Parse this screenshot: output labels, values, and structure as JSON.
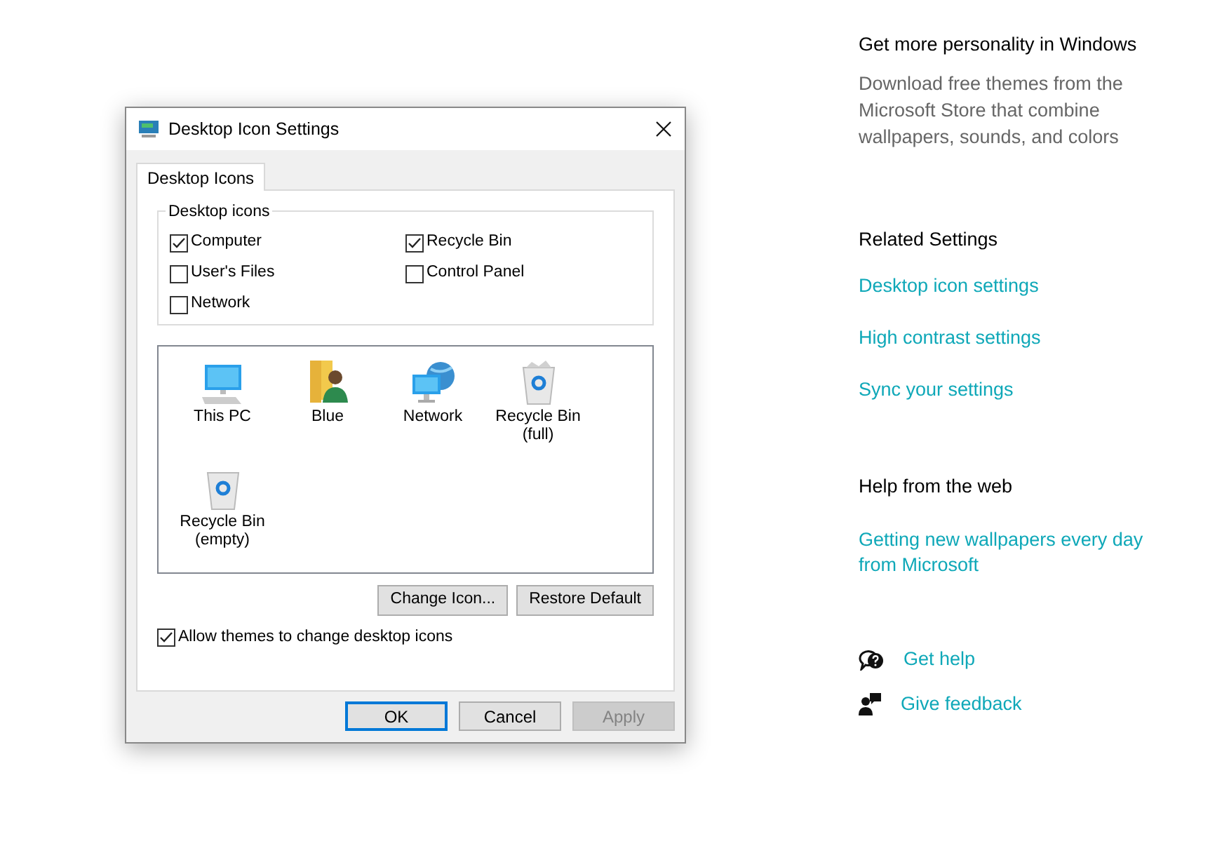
{
  "dialog": {
    "title": "Desktop Icon Settings",
    "tabs": [
      {
        "label": "Desktop Icons",
        "selected": true
      }
    ],
    "group_label": "Desktop icons",
    "checkboxes": [
      {
        "label": "Computer",
        "checked": true
      },
      {
        "label": "Recycle Bin",
        "checked": true
      },
      {
        "label": "User's Files",
        "checked": false
      },
      {
        "label": "Control Panel",
        "checked": false
      },
      {
        "label": "Network",
        "checked": false
      }
    ],
    "icons": [
      {
        "kind": "pc",
        "label": "This PC",
        "selected": false
      },
      {
        "kind": "user",
        "label": "Blue",
        "selected": false
      },
      {
        "kind": "network",
        "label": "Network",
        "selected": false
      },
      {
        "kind": "bin-full",
        "label": "Recycle Bin (full)",
        "selected": false
      },
      {
        "kind": "bin-empty",
        "label": "Recycle Bin (empty)",
        "selected": false
      }
    ],
    "icon_buttons": [
      "Change Icon...",
      "Restore Default"
    ],
    "allow_themes": {
      "label": "Allow themes to change desktop icons",
      "checked": true
    },
    "buttons": [
      {
        "label": "OK",
        "default": true,
        "disabled": false
      },
      {
        "label": "Cancel",
        "default": false,
        "disabled": false
      },
      {
        "label": "Apply",
        "default": false,
        "disabled": true
      }
    ]
  },
  "sidebar": {
    "personality": {
      "title": "Get more personality in Windows",
      "text": "Download free themes from the Microsoft Store that combine wallpapers, sounds, and colors"
    },
    "related": {
      "title": "Related Settings",
      "links": [
        "Desktop icon settings",
        "High contrast settings",
        "Sync your settings"
      ]
    },
    "help": {
      "title": "Help from the web",
      "links": [
        "Getting new wallpapers every day from Microsoft"
      ]
    },
    "actions": [
      {
        "kind": "help",
        "label": "Get help"
      },
      {
        "kind": "feedback",
        "label": "Give feedback"
      }
    ]
  }
}
